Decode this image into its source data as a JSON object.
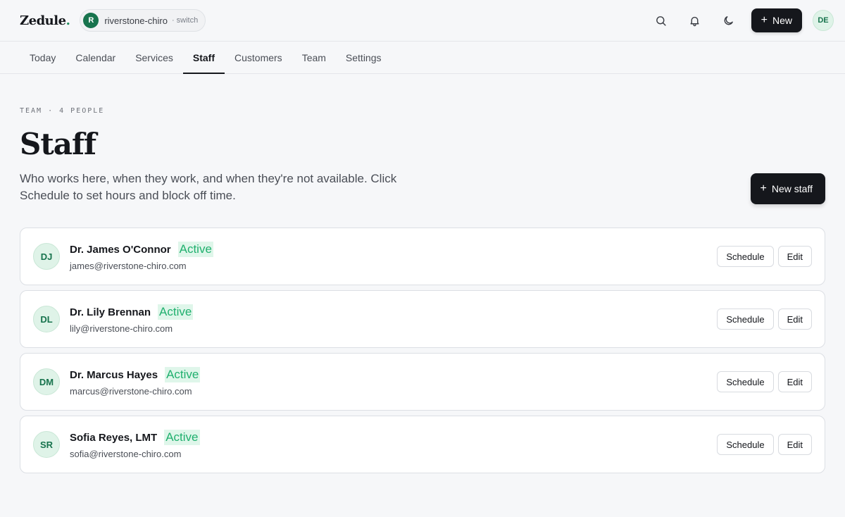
{
  "app": {
    "logo_text": "Zedule",
    "logo_dot": "."
  },
  "org": {
    "initial": "R",
    "name": "riverstone-chiro",
    "switch_label": "· switch"
  },
  "topbar": {
    "search_icon": "search-icon",
    "notifications_icon": "bell-icon",
    "theme_icon": "moon-icon",
    "new_plus": "+",
    "new_label": "New",
    "user_initials": "DE"
  },
  "tabs": [
    {
      "label": "Today",
      "active": false
    },
    {
      "label": "Calendar",
      "active": false
    },
    {
      "label": "Services",
      "active": false
    },
    {
      "label": "Staff",
      "active": true
    },
    {
      "label": "Customers",
      "active": false
    },
    {
      "label": "Team",
      "active": false
    },
    {
      "label": "Settings",
      "active": false
    }
  ],
  "header": {
    "eyebrow": "TEAM · 4 PEOPLE",
    "title": "Staff",
    "description": "Who works here, when they work, and when they're not available. Click Schedule to set hours and block off time.",
    "new_staff_plus": "+",
    "new_staff_label": "New staff"
  },
  "staff": [
    {
      "initials": "DJ",
      "name": "Dr. James O'Connor",
      "status": "Active",
      "email": "james@riverstone-chiro.com"
    },
    {
      "initials": "DL",
      "name": "Dr. Lily Brennan",
      "status": "Active",
      "email": "lily@riverstone-chiro.com"
    },
    {
      "initials": "DM",
      "name": "Dr. Marcus Hayes",
      "status": "Active",
      "email": "marcus@riverstone-chiro.com"
    },
    {
      "initials": "SR",
      "name": "Sofia Reyes, LMT",
      "status": "Active",
      "email": "sofia@riverstone-chiro.com"
    }
  ],
  "actions": {
    "schedule_label": "Schedule",
    "edit_label": "Edit"
  },
  "colors": {
    "accent": "#17734d",
    "active_status": "#20b06e",
    "primary_button": "#15171c"
  }
}
